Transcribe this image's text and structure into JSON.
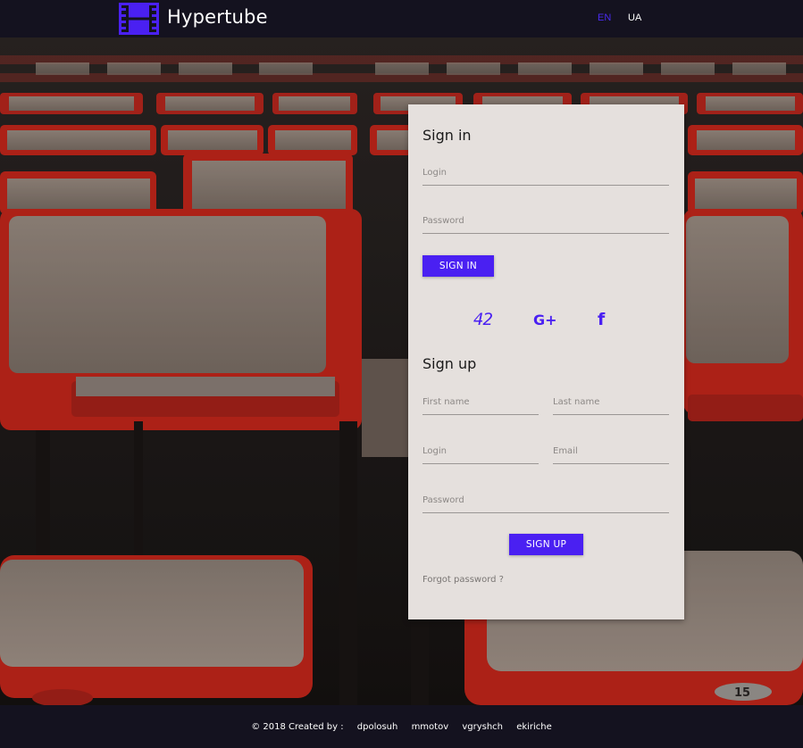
{
  "header": {
    "brand": "Hypertube",
    "logo_icon": "film-strip-icon",
    "languages": [
      "EN",
      "UA"
    ],
    "active_language": "EN"
  },
  "colors": {
    "accent": "#4a20f2",
    "header_bg": "#14121f",
    "card_bg": "#e5e0dd",
    "chair_red": "#c4261b",
    "chair_fabric": "#8a7d73"
  },
  "signin": {
    "title": "Sign in",
    "login_label": "Login",
    "password_label": "Password",
    "button": "SIGN IN"
  },
  "oauth": {
    "fortytwo_label": "42",
    "google_icon": "google-plus-icon",
    "google_label": "G+",
    "facebook_icon": "facebook-icon",
    "facebook_label": "f"
  },
  "signup": {
    "title": "Sign up",
    "first_name_label": "First name",
    "last_name_label": "Last name",
    "login_label": "Login",
    "email_label": "Email",
    "password_label": "Password",
    "button": "SIGN UP"
  },
  "forgot_password": "Forgot password ?",
  "footer": {
    "prefix": "© 2018 Created by :",
    "authors": [
      "dpolosuh",
      "mmotov",
      "vgryshch",
      "ekiriche"
    ]
  }
}
